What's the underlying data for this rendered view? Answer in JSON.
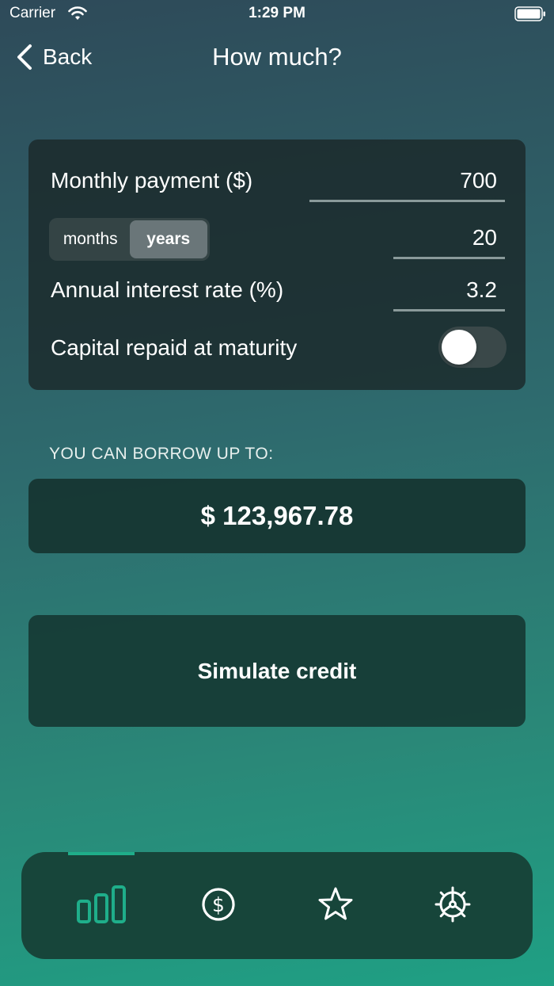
{
  "status_bar": {
    "carrier": "Carrier",
    "time": "1:29 PM"
  },
  "nav": {
    "back_label": "Back",
    "title": "How much?"
  },
  "form": {
    "monthly_payment_label": "Monthly payment ($)",
    "monthly_payment_value": "700",
    "duration_units": [
      "months",
      "years"
    ],
    "duration_selected": "years",
    "duration_value": "20",
    "interest_rate_label": "Annual interest rate (%)",
    "interest_rate_value": "3.2",
    "capital_repaid_label": "Capital repaid at maturity",
    "capital_repaid_on": false
  },
  "result": {
    "header": "YOU CAN BORROW UP TO:",
    "amount": "$ 123,967.78"
  },
  "simulate": {
    "label": "Simulate credit"
  },
  "tab_bar": {
    "selected": "calculator",
    "tabs": [
      {
        "id": "calculator",
        "icon": "bar-chart-icon"
      },
      {
        "id": "money",
        "icon": "dollar-circle-icon"
      },
      {
        "id": "favorites",
        "icon": "star-icon"
      },
      {
        "id": "settings",
        "icon": "gear-icon"
      }
    ]
  },
  "colors": {
    "accent": "#1fae8a",
    "tab_bar_bg": "#17453a",
    "card_bg": "#1b282a"
  }
}
